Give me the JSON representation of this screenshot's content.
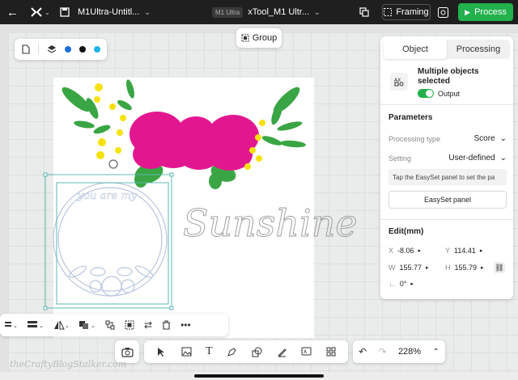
{
  "topbar": {
    "project_title": "M1Ultra-Untitl...",
    "device_tag": "M1 Ultra",
    "device_name": "xTool_M1 Ultr...",
    "framing_label": "Framing",
    "process_label": "Process",
    "accent_green": "#22b14c"
  },
  "left_toolbar": {
    "colors": [
      "#1e6fd9",
      "#111111",
      "#1cb3e8"
    ]
  },
  "group_button": {
    "label": "Group"
  },
  "panel": {
    "tabs": [
      "Object",
      "Processing"
    ],
    "active_tab": "Object",
    "selection_title": "Multiple objects selected",
    "output_label": "Output",
    "output_on": true,
    "parameters_heading": "Parameters",
    "processing_type_label": "Processing type",
    "processing_type_value": "Score",
    "setting_label": "Setting",
    "setting_value": "User-defined",
    "hint_text": "Tap the EasySet panel to set the pa",
    "easyset_label": "EasySet panel",
    "edit_heading": "Edit(mm)",
    "x_label": "X",
    "x_value": "-8.06",
    "y_label": "Y",
    "y_value": "114.41",
    "w_label": "W",
    "w_value": "155.77",
    "h_label": "H",
    "h_value": "155.79",
    "rotation_value": "0°"
  },
  "canvas": {
    "sunshine_text": "Sunshine",
    "wreath_text": "you are my"
  },
  "zoom": {
    "value": "228%"
  },
  "watermark": "theCraftyBlogStalker.com"
}
